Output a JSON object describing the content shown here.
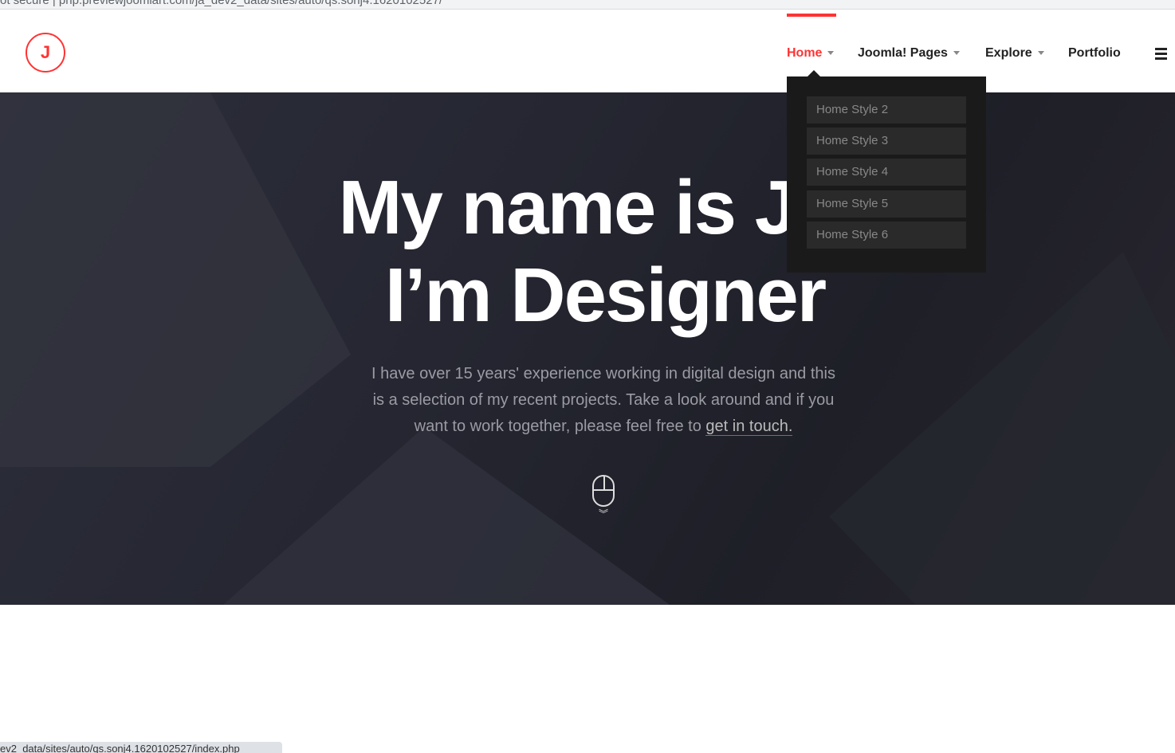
{
  "browser": {
    "url_text": "ot secure | php.previewjoomlart.com/ja_dev2_data/sites/auto/qs.sonj4.1620102527/",
    "status_url": "ev2_data/sites/auto/qs.sonj4.1620102527/index.php"
  },
  "logo": {
    "letter": "J"
  },
  "nav": {
    "items": [
      {
        "label": "Home"
      },
      {
        "label": "Joomla! Pages"
      },
      {
        "label": "Explore"
      },
      {
        "label": "Portfolio"
      }
    ],
    "accent": "#ff3333"
  },
  "dropdown": {
    "items": [
      "Home Style 2",
      "Home Style 3",
      "Home Style 4",
      "Home Style 5",
      "Home Style 6"
    ]
  },
  "hero": {
    "line1": "My name is Ja",
    "line2": "I’m Designer",
    "text_before": "I have over 15 years' experience working in digital design and this is a selection of my recent projects. Take a look around and if you want to work together, please feel free to ",
    "link": "get in touch."
  }
}
